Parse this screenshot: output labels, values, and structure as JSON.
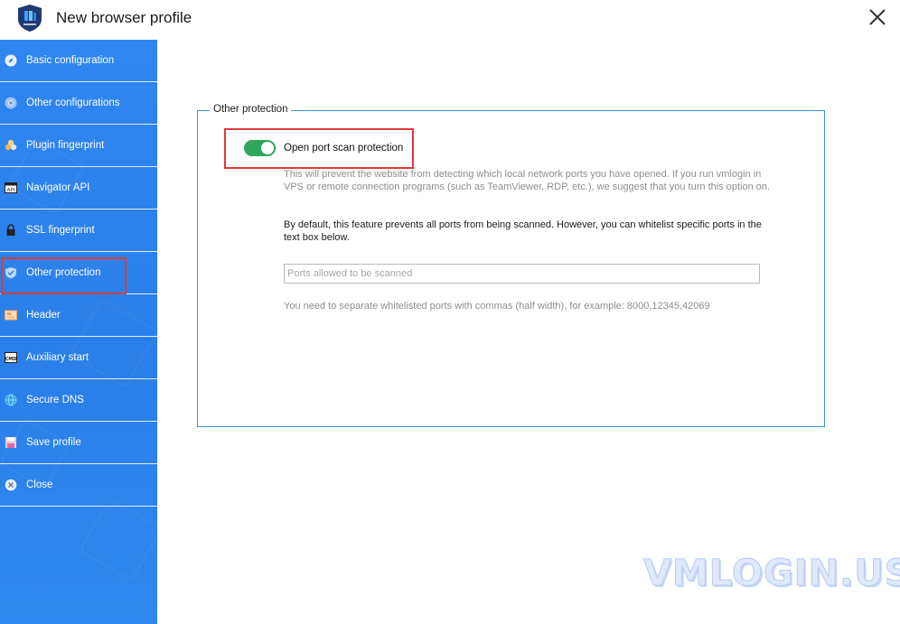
{
  "window": {
    "title": "New browser profile"
  },
  "sidebar": {
    "items": [
      {
        "label": "Basic configuration",
        "icon": "compass-icon"
      },
      {
        "label": "Other configurations",
        "icon": "chrome-icon"
      },
      {
        "label": "Plugin fingerprint",
        "icon": "plugin-icon"
      },
      {
        "label": "Navigator API",
        "icon": "api-icon"
      },
      {
        "label": "SSL fingerprint",
        "icon": "lock-icon"
      },
      {
        "label": "Other protection",
        "icon": "shield-icon",
        "selected": true
      },
      {
        "label": "Header",
        "icon": "header-icon"
      },
      {
        "label": "Auxiliary start",
        "icon": "cmd-icon"
      },
      {
        "label": "Secure DNS",
        "icon": "globe-icon"
      },
      {
        "label": "Save profile",
        "icon": "save-icon"
      },
      {
        "label": "Close",
        "icon": "close-circle-icon"
      }
    ]
  },
  "main": {
    "group_title": "Other protection",
    "toggle": {
      "label": "Open port scan protection",
      "on": true,
      "color": "#2fa65b"
    },
    "description": "This will prevent the website from detecting which local network ports you have opened. If you run vmlogin in VPS or remote connection programs (such as TeamViewer, RDP, etc.), we suggest that you turn this option on.",
    "default_note": "By default, this feature prevents all ports from being scanned. However, you can whitelist specific ports in the text box below.",
    "ports_input": {
      "value": "",
      "placeholder": "Ports allowed to be scanned"
    },
    "hint": "You need to separate whitelisted ports with commas (half width), for example: 8000,12345,42069"
  },
  "watermark": "VMLOGIN.US",
  "colors": {
    "sidebar": "#2a7fe9",
    "highlight": "#e03a3a",
    "group_border": "#3b8fd9"
  }
}
